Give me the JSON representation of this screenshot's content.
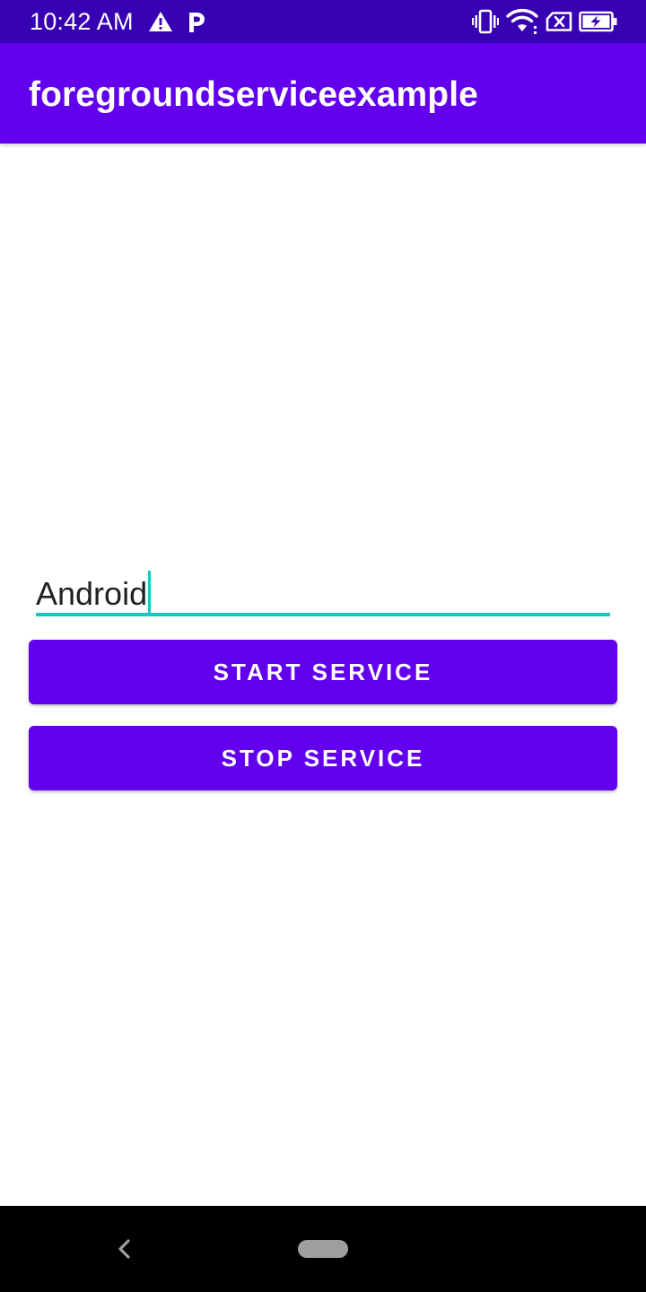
{
  "status_bar": {
    "time": "10:42 AM",
    "icons": [
      "warning-icon",
      "parking-icon",
      "vibrate-icon",
      "wifi-icon",
      "no-sim-icon",
      "battery-charging-icon"
    ],
    "background_color": "#3700b3"
  },
  "app_bar": {
    "title": "foregroundserviceexample",
    "background_color": "#6200ee"
  },
  "form": {
    "text_input": {
      "value": "Android",
      "focused": true,
      "accent_color": "#18c8c0"
    },
    "start_button": {
      "label": "START SERVICE"
    },
    "stop_button": {
      "label": "STOP SERVICE"
    },
    "button_color": "#6200ee"
  },
  "nav_bar": {
    "icons": [
      "back-icon",
      "home-pill-icon"
    ],
    "background_color": "#000000"
  }
}
